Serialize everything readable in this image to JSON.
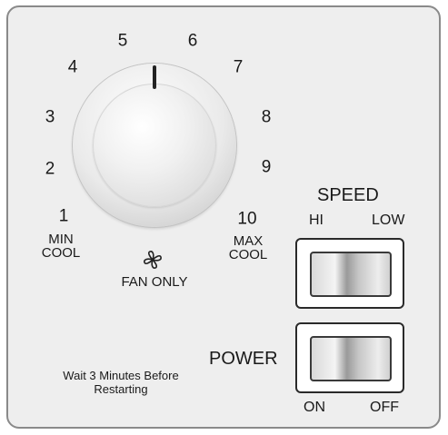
{
  "dial": {
    "positions": [
      "1",
      "2",
      "3",
      "4",
      "5",
      "6",
      "7",
      "8",
      "9",
      "10"
    ],
    "min_label": [
      "MIN",
      "COOL"
    ],
    "max_label": [
      "MAX",
      "COOL"
    ],
    "fan_only_label": "FAN ONLY",
    "fan_icon": "fan-icon"
  },
  "speed": {
    "title": "SPEED",
    "hi": "HI",
    "low": "LOW"
  },
  "power": {
    "title": "POWER",
    "on": "ON",
    "off": "OFF"
  },
  "note": [
    "Wait 3 Minutes Before",
    "Restarting"
  ]
}
